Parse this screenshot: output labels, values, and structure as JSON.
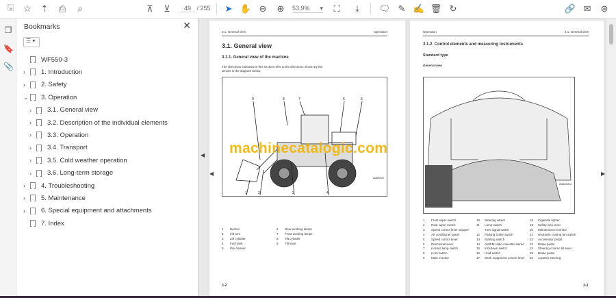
{
  "toolbar": {
    "page_current": "49",
    "page_total": "/ 255",
    "zoom": "53,9%"
  },
  "bookmarks": {
    "title": "Bookmarks",
    "items": [
      {
        "label": "WF550-3",
        "level": 0,
        "expand": ""
      },
      {
        "label": "1.  Introduction",
        "level": 0,
        "expand": "›"
      },
      {
        "label": "2.  Safety",
        "level": 0,
        "expand": "›"
      },
      {
        "label": "3.  Operation",
        "level": 0,
        "expand": "⌄"
      },
      {
        "label": "3.1.  General view",
        "level": 1,
        "expand": "›"
      },
      {
        "label": "3.2.  Description of the individual elements",
        "level": 1,
        "expand": "›"
      },
      {
        "label": "3.3.  Operation",
        "level": 1,
        "expand": "›"
      },
      {
        "label": "3.4.  Transport",
        "level": 1,
        "expand": "›"
      },
      {
        "label": "3.5.  Cold weather operation",
        "level": 1,
        "expand": "›"
      },
      {
        "label": "3.6.  Long-term storage",
        "level": 1,
        "expand": "›"
      },
      {
        "label": "4.  Troubleshooting",
        "level": 0,
        "expand": "›"
      },
      {
        "label": "5.  Maintenance",
        "level": 0,
        "expand": "›"
      },
      {
        "label": "6.  Special equipment and attachments",
        "level": 0,
        "expand": "›"
      },
      {
        "label": "7.  Index",
        "level": 0,
        "expand": ""
      }
    ]
  },
  "left_page": {
    "header_left": "3.1.  General view",
    "header_right": "Operation",
    "title": "3.1.    General view",
    "subtitle": "3.1.1.    General view of the machine",
    "intro": "The directions indicated in this section refer to the directions shown by the arrows in the diagram below.",
    "fig_code": "WA550M0",
    "legend": [
      [
        "1",
        "Bucket"
      ],
      [
        "2",
        "Lift arm"
      ],
      [
        "3",
        "Lift cylinder"
      ],
      [
        "4",
        "Fuel tank"
      ],
      [
        "5",
        "Pre cleaner"
      ],
      [
        "6",
        "Rear working lamps"
      ],
      [
        "7",
        "Front working lamps"
      ],
      [
        "8",
        "Tilt cylinder"
      ],
      [
        "9",
        "Tilt lever"
      ]
    ],
    "page_no": "3-2"
  },
  "right_page": {
    "header_left": "Operation",
    "header_right": "3.1.  General view",
    "subtitle": "3.1.2.    Control elements and measuring instruments",
    "type": "Standard type",
    "view": "General view",
    "fig_code": "WA550M14",
    "legend": [
      [
        "1",
        "Front wiper switch"
      ],
      [
        "2",
        "Rear wiper switch"
      ],
      [
        "3",
        "Speed control lever stopper"
      ],
      [
        "4",
        "Air conditioner panel"
      ],
      [
        "5",
        "Speed control lever"
      ],
      [
        "6",
        "Directional lever"
      ],
      [
        "7",
        "Hazard lamp switch"
      ],
      [
        "8",
        "Horn button"
      ],
      [
        "9",
        "Main monitor"
      ],
      [
        "10",
        "Steering wheel"
      ],
      [
        "11",
        "Lamp switch"
      ],
      [
        "",
        "Turn signal switch"
      ],
      [
        "12",
        "Parking brake switch"
      ],
      [
        "13",
        "Starting switch"
      ],
      [
        "14",
        "AM/FM radio-cassette stereo"
      ],
      [
        "15",
        "Kickdown switch"
      ],
      [
        "16",
        "Hold switch"
      ],
      [
        "17",
        "Work equipment control lever"
      ],
      [
        "18",
        "Cigarette lighter"
      ],
      [
        "19",
        "Safety lock lever"
      ],
      [
        "20",
        "Maintenance monitor"
      ],
      [
        "21",
        "Hydraulic cooling fan switch"
      ],
      [
        "22",
        "Accelerator pedal"
      ],
      [
        "23",
        "Brake pedal"
      ],
      [
        "24",
        "Steering column tilt lever"
      ],
      [
        "25",
        "Brake pedal"
      ],
      [
        "26",
        "Joystick steering"
      ]
    ],
    "page_no": "3-3"
  },
  "watermark": "machinecatalogic.com"
}
